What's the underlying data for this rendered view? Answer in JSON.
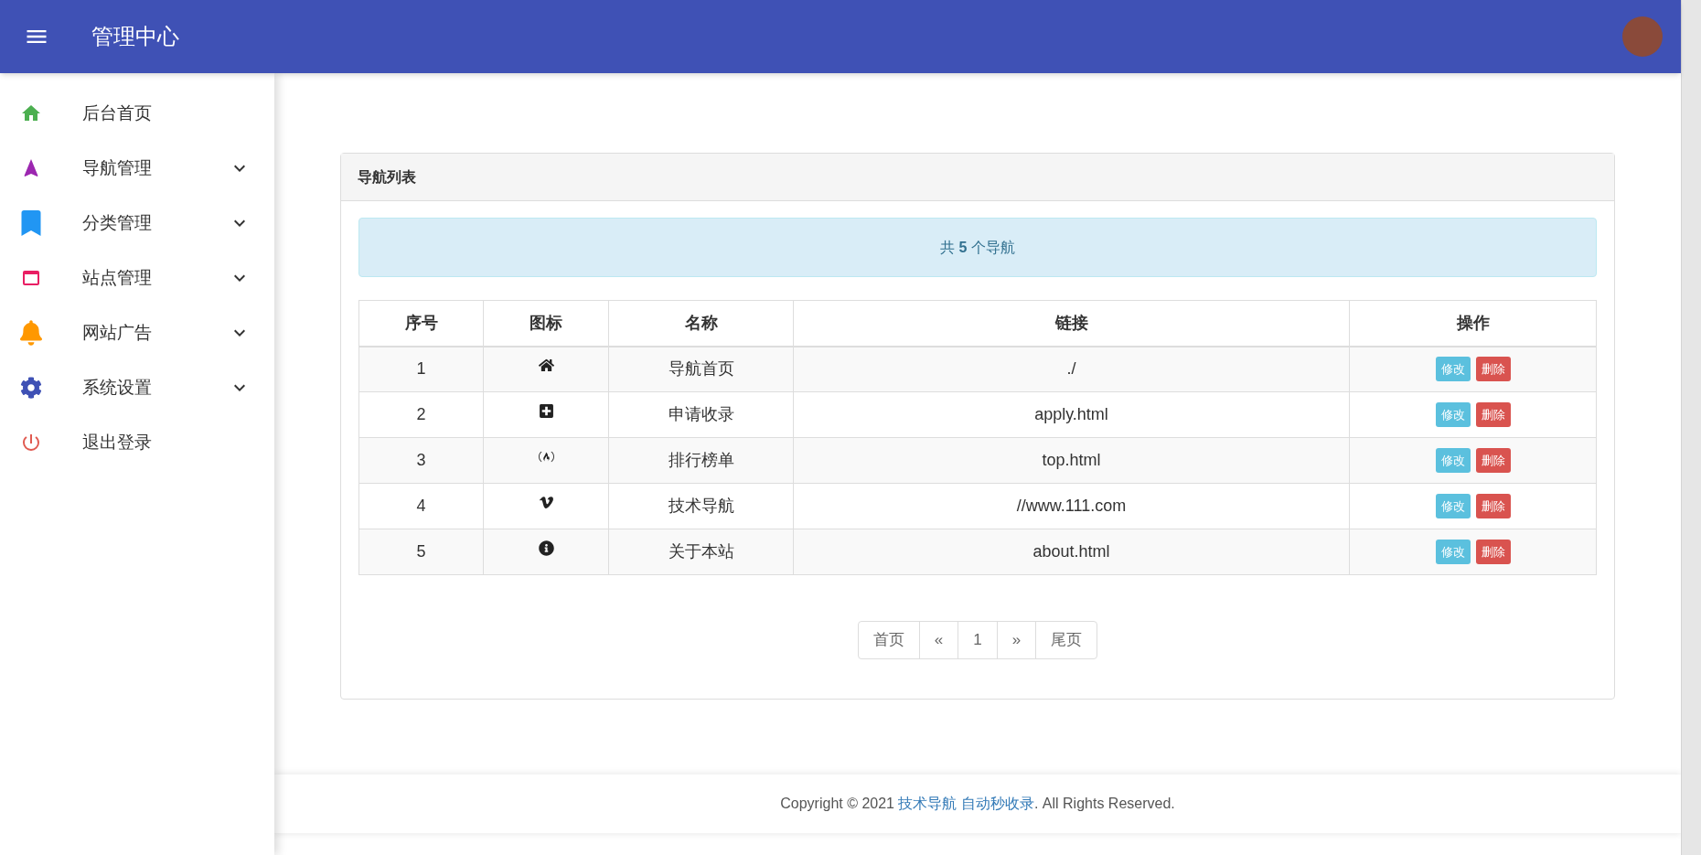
{
  "header": {
    "title": "管理中心"
  },
  "sidebar": {
    "items": [
      {
        "kind": "home",
        "label": "后台首页",
        "expandable": false
      },
      {
        "kind": "navigation",
        "label": "导航管理",
        "expandable": true
      },
      {
        "kind": "bookmark",
        "label": "分类管理",
        "expandable": true
      },
      {
        "kind": "site",
        "label": "站点管理",
        "expandable": true
      },
      {
        "kind": "bell",
        "label": "网站广告",
        "expandable": true
      },
      {
        "kind": "gear",
        "label": "系统设置",
        "expandable": true
      },
      {
        "kind": "power",
        "label": "退出登录",
        "expandable": false
      }
    ]
  },
  "panel": {
    "title": "导航列表",
    "notice": "共 **5** 个导航",
    "table": {
      "columns": [
        "序号",
        "图标",
        "名称",
        "链接",
        "操作"
      ],
      "rows": [
        {
          "index": "1",
          "kind": "home",
          "name": "导航首页",
          "link": "./",
          "actions": [
            "修改",
            "删除"
          ]
        },
        {
          "index": "2",
          "kind": "plus",
          "name": "申请收录",
          "link": "apply.html",
          "actions": [
            "修改",
            "删除"
          ]
        },
        {
          "index": "3",
          "kind": "fire",
          "name": "排行榜单",
          "link": "top.html",
          "actions": [
            "修改",
            "删除"
          ]
        },
        {
          "index": "4",
          "kind": "vimeo",
          "name": "技术导航",
          "link": "//www.111.com",
          "actions": [
            "修改",
            "删除"
          ]
        },
        {
          "index": "5",
          "kind": "info",
          "name": "关于本站",
          "link": "about.html",
          "actions": [
            "修改",
            "删除"
          ]
        }
      ]
    },
    "pagination": [
      {
        "label": "首页",
        "selected": false
      },
      {
        "label": "«",
        "selected": false
      },
      {
        "label": "1",
        "selected": false
      },
      {
        "label": "»",
        "selected": false
      },
      {
        "label": "尾页",
        "selected": false
      }
    ]
  },
  "footer": {
    "prefix": "Copyright © 2021 ",
    "link": "技术导航 自动秒收录",
    "suffix": ". All Rights Reserved."
  }
}
